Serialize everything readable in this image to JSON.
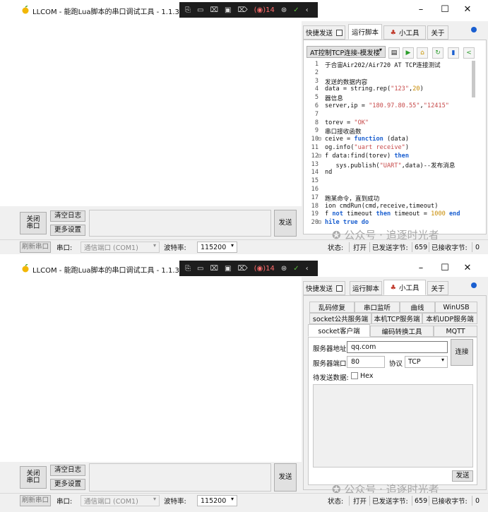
{
  "window": {
    "title": "LLCOM - 能跑Lua脚本的串口调试工具 - 1.1.3.3",
    "minimize": "–",
    "maximize": "☐",
    "close": "✕",
    "taskbar_items": [
      "⎘",
      "▭",
      "⌧",
      "▣",
      "⌦",
      "(◉)14",
      "⊛",
      "✓",
      "‹"
    ]
  },
  "tabs": {
    "quick_send": "快捷发送",
    "run_script": "运行脚本",
    "tools": "小工具",
    "about": "关于",
    "accent_color": "#1a5fd0"
  },
  "script": {
    "selected": "AT控制TCP连接-模发楼",
    "lines": [
      {
        "n": "1",
        "t": "于合宙Air202/Air720 AT TCP连接测试"
      },
      {
        "n": "2",
        "t": ""
      },
      {
        "n": "3",
        "t": "发送的数据内容"
      },
      {
        "n": "4",
        "t": "data = string.rep(\"123\",20)"
      },
      {
        "n": "5",
        "t": "器信息"
      },
      {
        "n": "6",
        "t": "server,ip = \"180.97.80.55\",\"12415\""
      },
      {
        "n": "7",
        "t": ""
      },
      {
        "n": "8",
        "t": "torev = \"OK\""
      },
      {
        "n": "9",
        "t": "串口接收函数"
      },
      {
        "n": "10",
        "t": "ceive = function (data)"
      },
      {
        "n": "11",
        "t": "og.info(\"uart receive\")"
      },
      {
        "n": "12",
        "t": "f data:find(torev) then"
      },
      {
        "n": "13",
        "t": "   sys.publish(\"UART\",data)--发布消息"
      },
      {
        "n": "14",
        "t": "nd"
      },
      {
        "n": "15",
        "t": ""
      },
      {
        "n": "16",
        "t": ""
      },
      {
        "n": "17",
        "t": "跑某命令，直到成功"
      },
      {
        "n": "18",
        "t": "ion cmdRun(cmd,receive,timeout)"
      },
      {
        "n": "19",
        "t": "f not timeout then timeout = 1000 end"
      },
      {
        "n": "20",
        "t": "hile true do"
      }
    ]
  },
  "left_controls": {
    "close_port": "关闭\n串口",
    "clear_log": "清空日志",
    "more_settings": "更多设置",
    "send": "发送"
  },
  "status_bar": {
    "refresh_port": "刷新串口",
    "port_label": "串口:",
    "port_value": "通信端口 (COM1)",
    "baud_label": "波特率:",
    "baud_value": "115200",
    "status_label": "状态:",
    "status_value": "打开",
    "sent_label": "已发送字节:",
    "sent_value": "659",
    "recv_label": "已接收字节:",
    "recv_value": "0"
  },
  "tools_panel": {
    "row1": [
      "乱码修复",
      "串口监听",
      "曲线",
      "WinUSB"
    ],
    "row2": [
      "socket公共服务端",
      "本机TCP服务端",
      "本机UDP服务端"
    ],
    "row3": [
      "socket客户端",
      "编码转换工具",
      "MQTT"
    ],
    "server_addr_label": "服务器地址",
    "server_addr_value": "qq.com",
    "server_port_label": "服务器端口",
    "server_port_value": "80",
    "protocol_label": "协议",
    "protocol_value": "TCP",
    "connect": "连接",
    "pending_label": "待发送数据:",
    "hex_label": "Hex",
    "send": "发送"
  },
  "watermark": "公众号 · 追逐时光者"
}
